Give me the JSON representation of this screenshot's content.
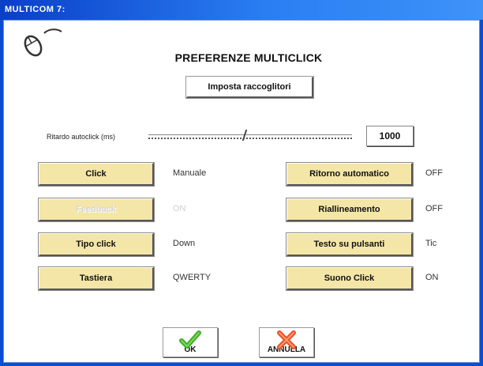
{
  "window": {
    "title": "MULTICOM 7:"
  },
  "header": {
    "title": "PREFERENZE MULTICLICK"
  },
  "setup_button": {
    "label": "Imposta raccoglitori"
  },
  "autoclick": {
    "label": "Ritardo autoclick (ms)",
    "value": "1000",
    "slider_position": 0.47
  },
  "left_options": [
    {
      "label": "Click",
      "value": "Manuale",
      "enabled": true
    },
    {
      "label": "Feedback",
      "value": "ON",
      "enabled": false
    },
    {
      "label": "Tipo click",
      "value": "Down",
      "enabled": true
    },
    {
      "label": "Tastiera",
      "value": "QWERTY",
      "enabled": true
    }
  ],
  "right_options": [
    {
      "label": "Ritorno automatico",
      "value": "OFF",
      "enabled": true
    },
    {
      "label": "Riallineamento",
      "value": "OFF",
      "enabled": true
    },
    {
      "label": "Testo su pulsanti",
      "value": "Tic",
      "enabled": true
    },
    {
      "label": "Suono Click",
      "value": "ON",
      "enabled": true
    }
  ],
  "footer": {
    "ok_label": "OK",
    "cancel_label": "ANNULLA"
  },
  "icons": {
    "mouse": "mouse-icon",
    "ok": "checkmark-icon",
    "cancel": "cross-icon"
  },
  "colors": {
    "title_bar": "#0a4fd0",
    "button_fill": "#f4e6a6",
    "ok_icon": "#3fae2a",
    "cancel_icon": "#e8502a"
  }
}
